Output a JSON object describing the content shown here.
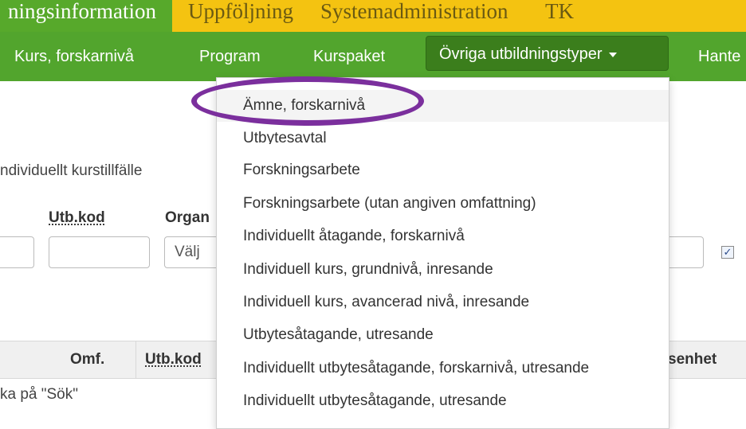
{
  "top_tabs": [
    {
      "label": "ningsinformation"
    },
    {
      "label": "Uppföljning"
    },
    {
      "label": "Systemadministration"
    },
    {
      "label": "TK"
    }
  ],
  "nav": {
    "items": [
      {
        "label": "Kurs, forskarnivå"
      },
      {
        "label": "Program"
      },
      {
        "label": "Kurspaket"
      },
      {
        "label": "Övriga utbildningstyper"
      },
      {
        "label": "Hante"
      }
    ]
  },
  "page": {
    "subtitle": "ndividuellt kurstillfälle",
    "filters": {
      "utbkod_label": "Utb.kod",
      "org_label": "Organ",
      "org_value": "Välj",
      "checkbox_checked": true
    },
    "table": {
      "headers": [
        "Omf.",
        "Utb.kod",
        "senhet"
      ],
      "hint": "ka på \"Sök\""
    }
  },
  "menu": {
    "items": [
      {
        "label": "Ämne, forskarnivå"
      },
      {
        "label": "Utbytesavtal"
      },
      {
        "label": "Forskningsarbete"
      },
      {
        "label": "Forskningsarbete (utan angiven omfattning)"
      },
      {
        "label": "Individuellt åtagande, forskarnivå"
      },
      {
        "label": "Individuell kurs, grundnivå, inresande"
      },
      {
        "label": "Individuell kurs, avancerad nivå, inresande"
      },
      {
        "label": "Utbytesåtagande, utresande"
      },
      {
        "label": "Individuellt utbytesåtagande, forskarnivå, utresande"
      },
      {
        "label": "Individuellt utbytesåtagande, utresande"
      }
    ]
  },
  "colors": {
    "top_bar": "#f4c311",
    "nav_bar": "#52a52d",
    "nav_active": "#3b7e1c",
    "annotation": "#7b2f9d"
  }
}
